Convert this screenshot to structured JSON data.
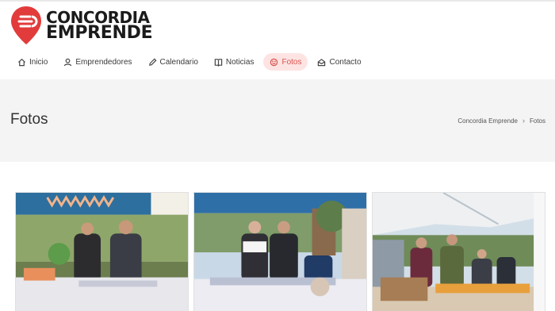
{
  "site": {
    "logo_line1": "CONCORDIA",
    "logo_line2": "EMPRENDE",
    "brand_color": "#e23b3b"
  },
  "nav": {
    "items": [
      {
        "label": "Inicio",
        "icon": "home-icon"
      },
      {
        "label": "Emprendedores",
        "icon": "user-icon"
      },
      {
        "label": "Calendario",
        "icon": "pencil-icon"
      },
      {
        "label": "Noticias",
        "icon": "book-icon"
      },
      {
        "label": "Fotos",
        "icon": "smile-icon",
        "active": true
      },
      {
        "label": "Contacto",
        "icon": "contact-icon"
      }
    ]
  },
  "page": {
    "title": "Fotos",
    "breadcrumb": [
      "Concordia Emprende",
      "Fotos"
    ]
  },
  "gallery": {
    "photos": [
      "photo-market-stall-1",
      "photo-market-stall-2",
      "photo-market-stall-3"
    ]
  }
}
